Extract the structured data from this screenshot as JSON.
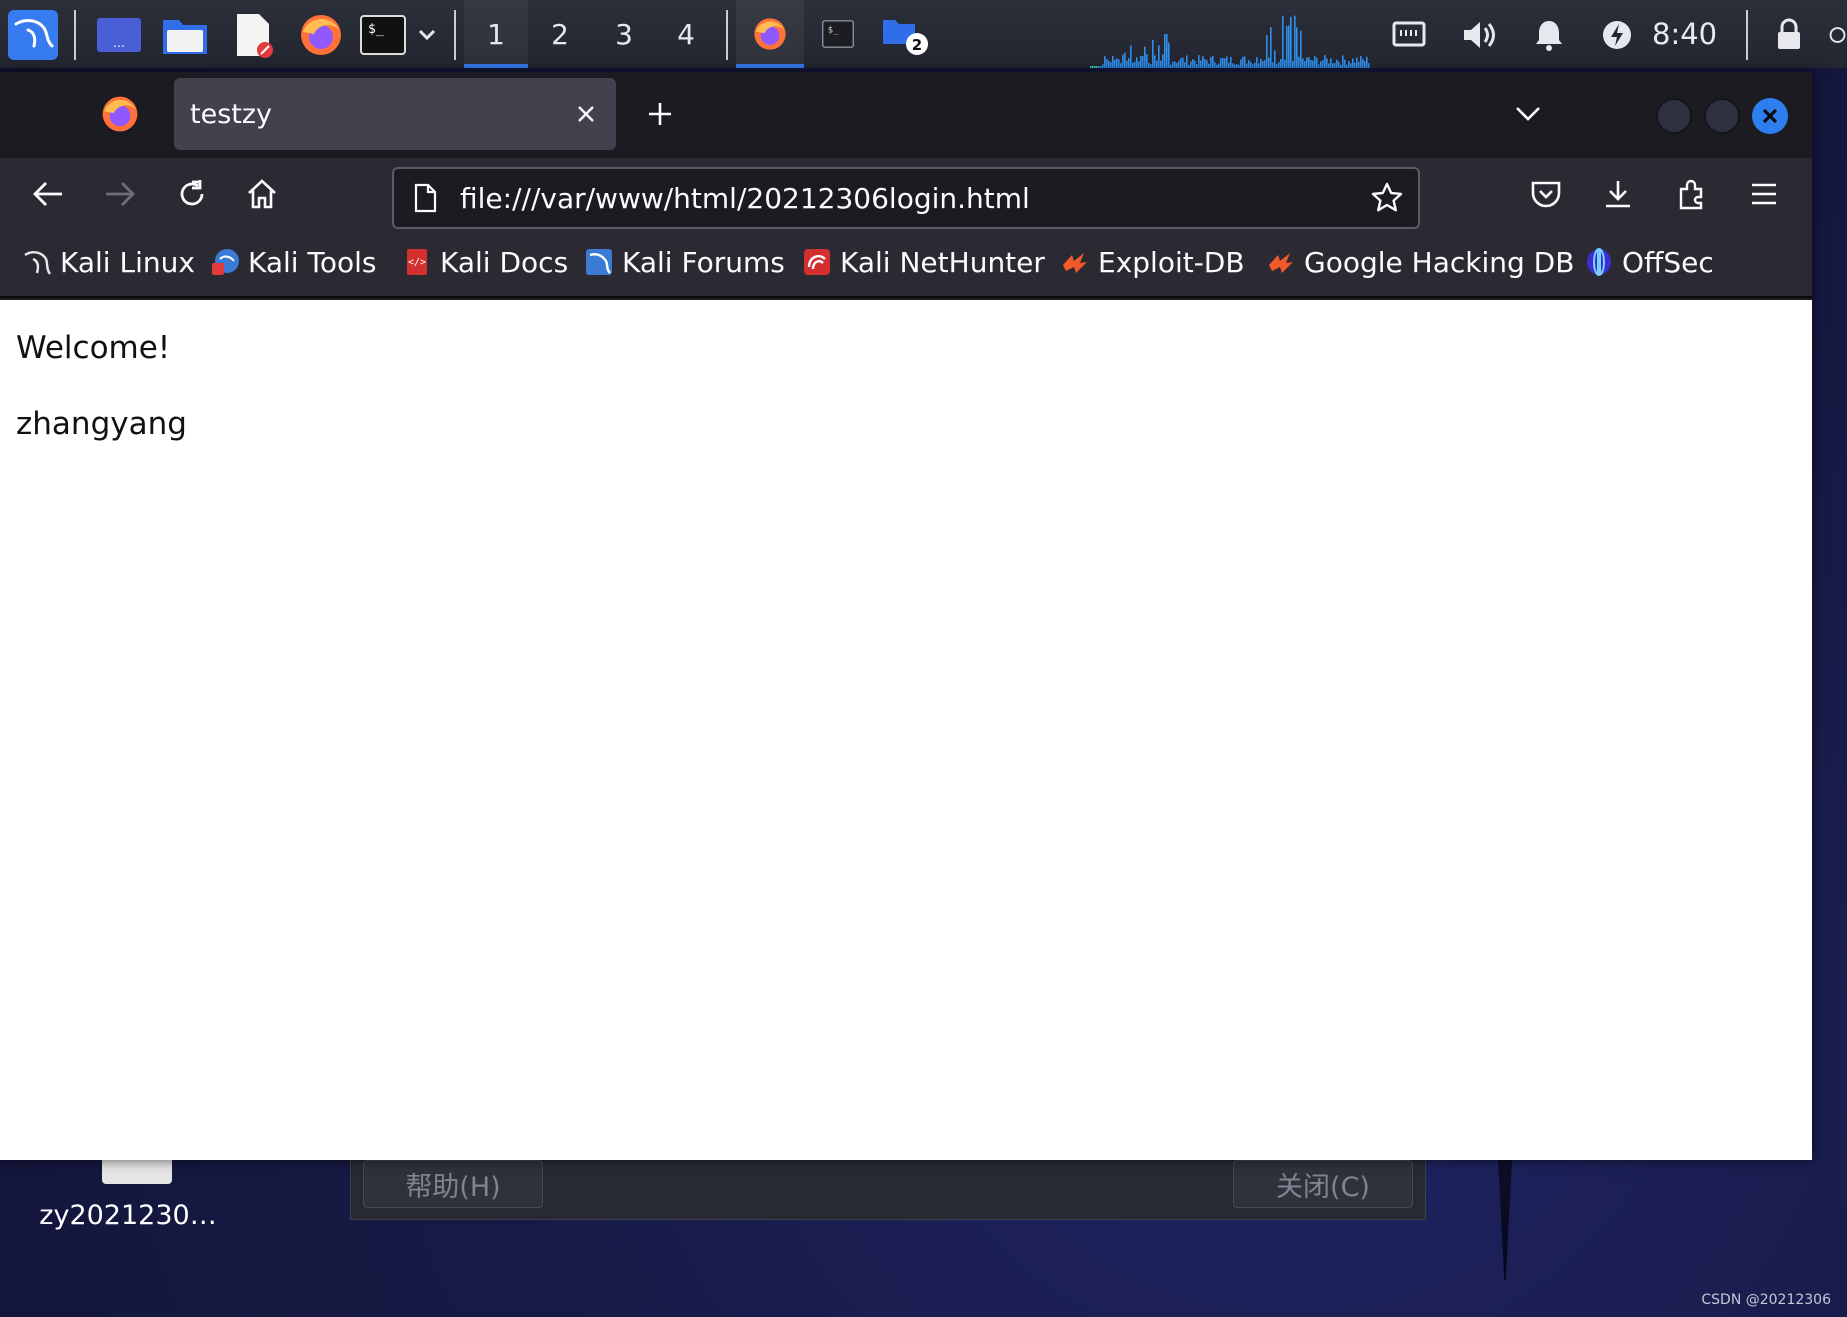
{
  "taskbar": {
    "workspaces": [
      "1",
      "2",
      "3",
      "4"
    ],
    "active_workspace": "1",
    "folder_badge": "2",
    "clock": "8:40",
    "accent_color": "#367bf0"
  },
  "browser": {
    "tab_title": "testzy",
    "url": "file:///var/www/html/20212306login.html",
    "bookmarks": [
      {
        "label": "Kali Linux",
        "icon": "kali-dragon-icon"
      },
      {
        "label": "Kali Tools",
        "icon": "kali-tools-icon"
      },
      {
        "label": "Kali Docs",
        "icon": "kali-docs-icon"
      },
      {
        "label": "Kali Forums",
        "icon": "kali-forums-icon"
      },
      {
        "label": "Kali NetHunter",
        "icon": "kali-nethunter-icon"
      },
      {
        "label": "Exploit-DB",
        "icon": "exploit-db-icon"
      },
      {
        "label": "Google Hacking DB",
        "icon": "ghdb-icon"
      },
      {
        "label": "OffSec",
        "icon": "offsec-icon"
      }
    ]
  },
  "page": {
    "line1": "Welcome!",
    "line2": "zhangyang"
  },
  "background_dialog": {
    "help_button": "帮助(H)",
    "close_button": "关闭(C)"
  },
  "desktop": {
    "file_label": "zy2021230…"
  },
  "watermark": "CSDN @20212306"
}
